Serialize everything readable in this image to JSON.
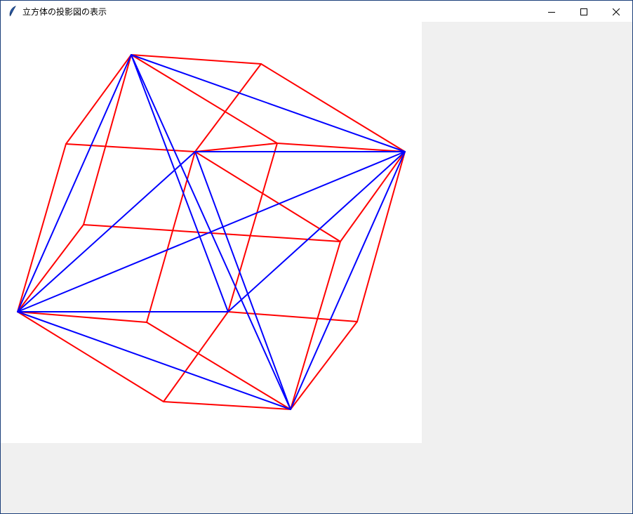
{
  "window": {
    "title": "立方体の投影図の表示",
    "icon": "feather-icon",
    "controls": {
      "minimize_icon": "minimize-icon",
      "maximize_icon": "maximize-icon",
      "close_icon": "close-icon"
    }
  },
  "colors": {
    "cube_edges": "#ff0000",
    "face_diagonals": "#0000ff",
    "canvas_background": "#ffffff",
    "window_background": "#f0f0f0"
  }
}
